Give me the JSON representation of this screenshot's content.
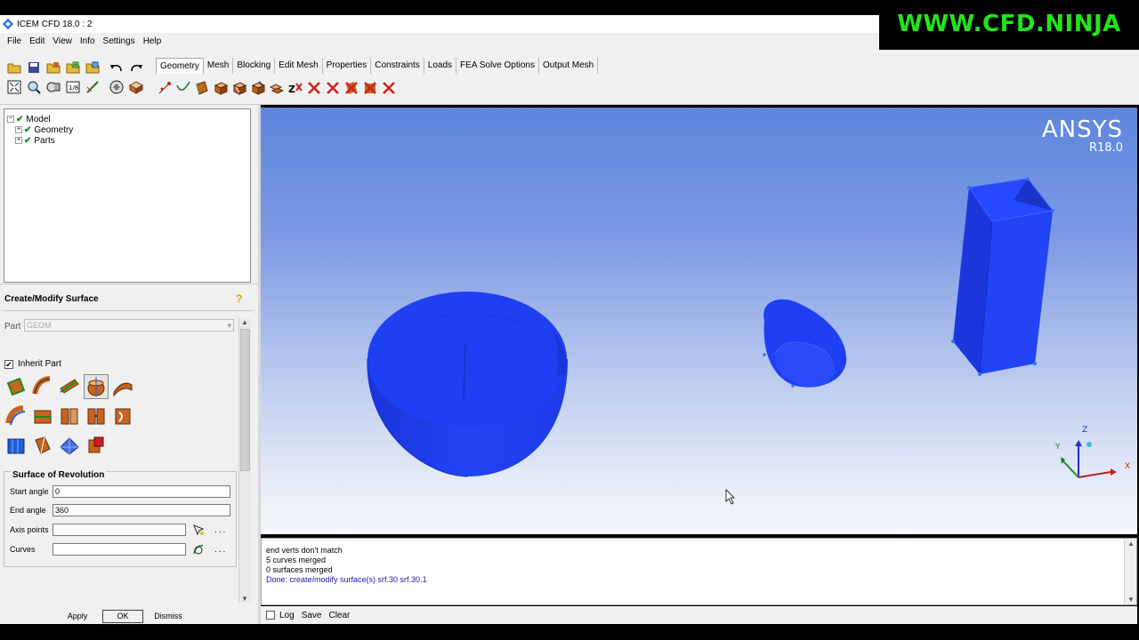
{
  "window": {
    "title": "ICEM CFD 18.0 : 2"
  },
  "watermark": "WWW.CFD.NINJA",
  "menu": [
    "File",
    "Edit",
    "View",
    "Info",
    "Settings",
    "Help"
  ],
  "tabs": [
    "Geometry",
    "Mesh",
    "Blocking",
    "Edit Mesh",
    "Properties",
    "Constraints",
    "Loads",
    "FEA Solve Options",
    "Output Mesh"
  ],
  "tree": {
    "root": "Model",
    "children": [
      "Geometry",
      "Parts"
    ]
  },
  "panel": {
    "title": "Create/Modify Surface",
    "part_label": "Part",
    "part_value": "GEOM",
    "inherit_label": "Inherit Part",
    "inherit_checked": "✔",
    "section_title": "Surface of Revolution",
    "fields": {
      "start_angle": {
        "label": "Start angle",
        "value": "0"
      },
      "end_angle": {
        "label": "End angle",
        "value": "360"
      },
      "axis_points": {
        "label": "Axis points",
        "value": ""
      },
      "curves": {
        "label": "Curves",
        "value": ""
      }
    },
    "dots": "...",
    "buttons": {
      "apply": "Apply",
      "ok": "OK",
      "dismiss": "Dismiss"
    }
  },
  "viewport": {
    "logo": "ANSYS",
    "release": "R18.0"
  },
  "axes": {
    "x": "X",
    "y": "Y",
    "z": "Z"
  },
  "messages": [
    "end verts don't match",
    "5 curves merged",
    "0 surfaces merged",
    "Done: create/modify surface(s) srf.30 srf.30.1"
  ],
  "logbar": {
    "log": "Log",
    "save": "Save",
    "clear": "Clear"
  },
  "colors": {
    "surface": "#1f3ff2",
    "surface_dark": "#1a34c8",
    "edge_point": "#3a6cff",
    "watermark": "#22e51b"
  }
}
